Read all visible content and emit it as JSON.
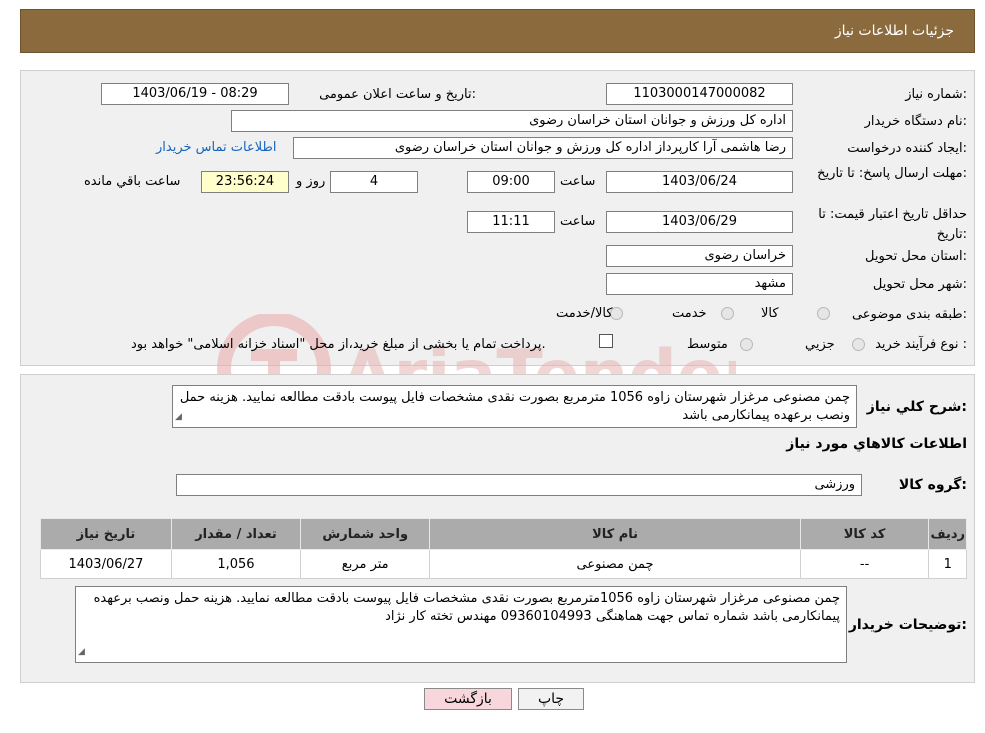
{
  "header": {
    "title": "جزئیات اطلاعات نیاز"
  },
  "watermark": {
    "text": "AriaTender.neT"
  },
  "form": {
    "need_number_label": "شماره نیاز:",
    "need_number": "1103000147000082",
    "announce_label": "تاریخ و ساعت اعلان عمومی:",
    "announce_value": "1403/06/19 - 08:29",
    "buyer_org_label": "نام دستگاه خریدار:",
    "buyer_org": "اداره کل ورزش و جوانان استان خراسان رضوی",
    "creator_label": "ایجاد کننده درخواست:",
    "creator": "رضا هاشمی آرا کارپرداز اداره کل ورزش و جوانان استان خراسان رضوی",
    "contact_link": "اطلاعات تماس خریدار",
    "deadline_label": "مهلت ارسال پاسخ: تا تاریخ:",
    "deadline_date": "1403/06/24",
    "time_label": "ساعت",
    "deadline_time": "09:00",
    "days": "4",
    "day_label": "روز و",
    "remaining_time": "23:56:24",
    "remaining_label": "ساعت باقي مانده",
    "validity_label": "حداقل تاریخ اعتبار قیمت: تا تاریخ:",
    "validity_date": "1403/06/29",
    "validity_time": "11:11",
    "province_label": "استان محل تحویل:",
    "province": "خراسان رضوی",
    "city_label": "شهر محل تحویل:",
    "city": "مشهد",
    "category_label": "طبقه بندی موضوعی:",
    "category_options": [
      "کالا",
      "خدمت",
      "کالا/خدمت"
    ],
    "process_label": "نوع فرآیند خرید :",
    "process_options": [
      "جزیي",
      "متوسط"
    ],
    "payment_note": "پرداخت تمام یا بخشی از مبلغ خرید،از محل \"اسناد خزانه اسلامی\" خواهد بود."
  },
  "summary": {
    "label": "شرح کلي نياز:",
    "text": "چمن مصنوعی مرغزار شهرستان زاوه 1056 مترمربع بصورت نقدی مشخصات فایل پیوست بادقت مطالعه نمایید. هزینه حمل ونصب برعهده پیمانکارمی باشد",
    "goods_info_title": "اطلاعات کالاهاي مورد نياز",
    "goods_group_label": "گروه کالا:",
    "goods_group": "ورزشی"
  },
  "table": {
    "headers": [
      "رديف",
      "کد کالا",
      "نام کالا",
      "واحد شمارش",
      "تعداد / مقدار",
      "تاریخ نیاز"
    ],
    "rows": [
      [
        "1",
        "--",
        "چمن مصنوعی",
        "متر مربع",
        "1,056",
        "1403/06/27"
      ]
    ]
  },
  "buyer_notes": {
    "label": "توضیحات خریدار:",
    "text": "چمن مصنوعی مرغزار شهرستان زاوه 1056مترمربع بصورت نقدی مشخصات فایل پیوست بادقت مطالعه نمایید. هزینه حمل ونصب برعهده پیمانکارمی باشد شماره تماس جهت هماهنگی 09360104993 مهندس تخته کار نژاد"
  },
  "buttons": {
    "print": "چاپ",
    "back": "بازگشت"
  },
  "colors": {
    "header_bg": "#8b6b3e",
    "panel_bg": "#f0f0f0",
    "remaining_bg": "#ffffcc",
    "link": "#1565c0",
    "back_btn_bg": "#f8d7dc"
  }
}
